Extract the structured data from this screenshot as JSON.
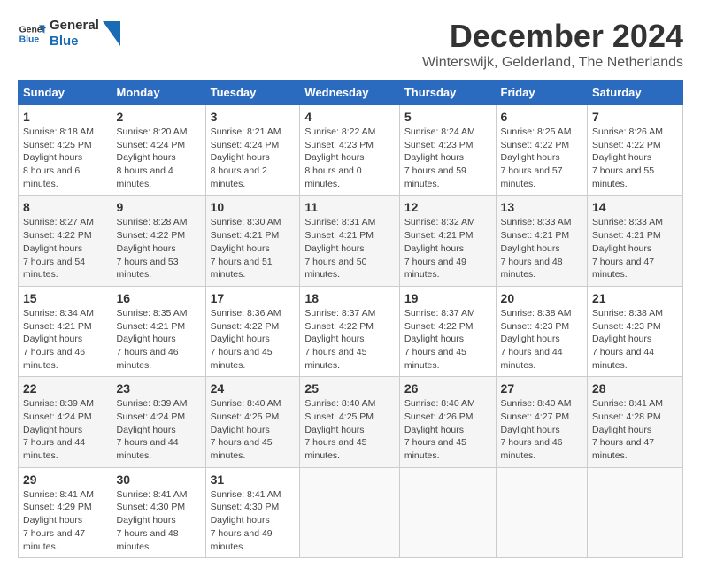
{
  "logo": {
    "line1": "General",
    "line2": "Blue"
  },
  "title": "December 2024",
  "subtitle": "Winterswijk, Gelderland, The Netherlands",
  "days_header": [
    "Sunday",
    "Monday",
    "Tuesday",
    "Wednesday",
    "Thursday",
    "Friday",
    "Saturday"
  ],
  "weeks": [
    [
      {
        "day": "1",
        "sunrise": "8:18 AM",
        "sunset": "4:25 PM",
        "daylight": "8 hours and 6 minutes."
      },
      {
        "day": "2",
        "sunrise": "8:20 AM",
        "sunset": "4:24 PM",
        "daylight": "8 hours and 4 minutes."
      },
      {
        "day": "3",
        "sunrise": "8:21 AM",
        "sunset": "4:24 PM",
        "daylight": "8 hours and 2 minutes."
      },
      {
        "day": "4",
        "sunrise": "8:22 AM",
        "sunset": "4:23 PM",
        "daylight": "8 hours and 0 minutes."
      },
      {
        "day": "5",
        "sunrise": "8:24 AM",
        "sunset": "4:23 PM",
        "daylight": "7 hours and 59 minutes."
      },
      {
        "day": "6",
        "sunrise": "8:25 AM",
        "sunset": "4:22 PM",
        "daylight": "7 hours and 57 minutes."
      },
      {
        "day": "7",
        "sunrise": "8:26 AM",
        "sunset": "4:22 PM",
        "daylight": "7 hours and 55 minutes."
      }
    ],
    [
      {
        "day": "8",
        "sunrise": "8:27 AM",
        "sunset": "4:22 PM",
        "daylight": "7 hours and 54 minutes."
      },
      {
        "day": "9",
        "sunrise": "8:28 AM",
        "sunset": "4:22 PM",
        "daylight": "7 hours and 53 minutes."
      },
      {
        "day": "10",
        "sunrise": "8:30 AM",
        "sunset": "4:21 PM",
        "daylight": "7 hours and 51 minutes."
      },
      {
        "day": "11",
        "sunrise": "8:31 AM",
        "sunset": "4:21 PM",
        "daylight": "7 hours and 50 minutes."
      },
      {
        "day": "12",
        "sunrise": "8:32 AM",
        "sunset": "4:21 PM",
        "daylight": "7 hours and 49 minutes."
      },
      {
        "day": "13",
        "sunrise": "8:33 AM",
        "sunset": "4:21 PM",
        "daylight": "7 hours and 48 minutes."
      },
      {
        "day": "14",
        "sunrise": "8:33 AM",
        "sunset": "4:21 PM",
        "daylight": "7 hours and 47 minutes."
      }
    ],
    [
      {
        "day": "15",
        "sunrise": "8:34 AM",
        "sunset": "4:21 PM",
        "daylight": "7 hours and 46 minutes."
      },
      {
        "day": "16",
        "sunrise": "8:35 AM",
        "sunset": "4:21 PM",
        "daylight": "7 hours and 46 minutes."
      },
      {
        "day": "17",
        "sunrise": "8:36 AM",
        "sunset": "4:22 PM",
        "daylight": "7 hours and 45 minutes."
      },
      {
        "day": "18",
        "sunrise": "8:37 AM",
        "sunset": "4:22 PM",
        "daylight": "7 hours and 45 minutes."
      },
      {
        "day": "19",
        "sunrise": "8:37 AM",
        "sunset": "4:22 PM",
        "daylight": "7 hours and 45 minutes."
      },
      {
        "day": "20",
        "sunrise": "8:38 AM",
        "sunset": "4:23 PM",
        "daylight": "7 hours and 44 minutes."
      },
      {
        "day": "21",
        "sunrise": "8:38 AM",
        "sunset": "4:23 PM",
        "daylight": "7 hours and 44 minutes."
      }
    ],
    [
      {
        "day": "22",
        "sunrise": "8:39 AM",
        "sunset": "4:24 PM",
        "daylight": "7 hours and 44 minutes."
      },
      {
        "day": "23",
        "sunrise": "8:39 AM",
        "sunset": "4:24 PM",
        "daylight": "7 hours and 44 minutes."
      },
      {
        "day": "24",
        "sunrise": "8:40 AM",
        "sunset": "4:25 PM",
        "daylight": "7 hours and 45 minutes."
      },
      {
        "day": "25",
        "sunrise": "8:40 AM",
        "sunset": "4:25 PM",
        "daylight": "7 hours and 45 minutes."
      },
      {
        "day": "26",
        "sunrise": "8:40 AM",
        "sunset": "4:26 PM",
        "daylight": "7 hours and 45 minutes."
      },
      {
        "day": "27",
        "sunrise": "8:40 AM",
        "sunset": "4:27 PM",
        "daylight": "7 hours and 46 minutes."
      },
      {
        "day": "28",
        "sunrise": "8:41 AM",
        "sunset": "4:28 PM",
        "daylight": "7 hours and 47 minutes."
      }
    ],
    [
      {
        "day": "29",
        "sunrise": "8:41 AM",
        "sunset": "4:29 PM",
        "daylight": "7 hours and 47 minutes."
      },
      {
        "day": "30",
        "sunrise": "8:41 AM",
        "sunset": "4:30 PM",
        "daylight": "7 hours and 48 minutes."
      },
      {
        "day": "31",
        "sunrise": "8:41 AM",
        "sunset": "4:30 PM",
        "daylight": "7 hours and 49 minutes."
      },
      null,
      null,
      null,
      null
    ]
  ]
}
